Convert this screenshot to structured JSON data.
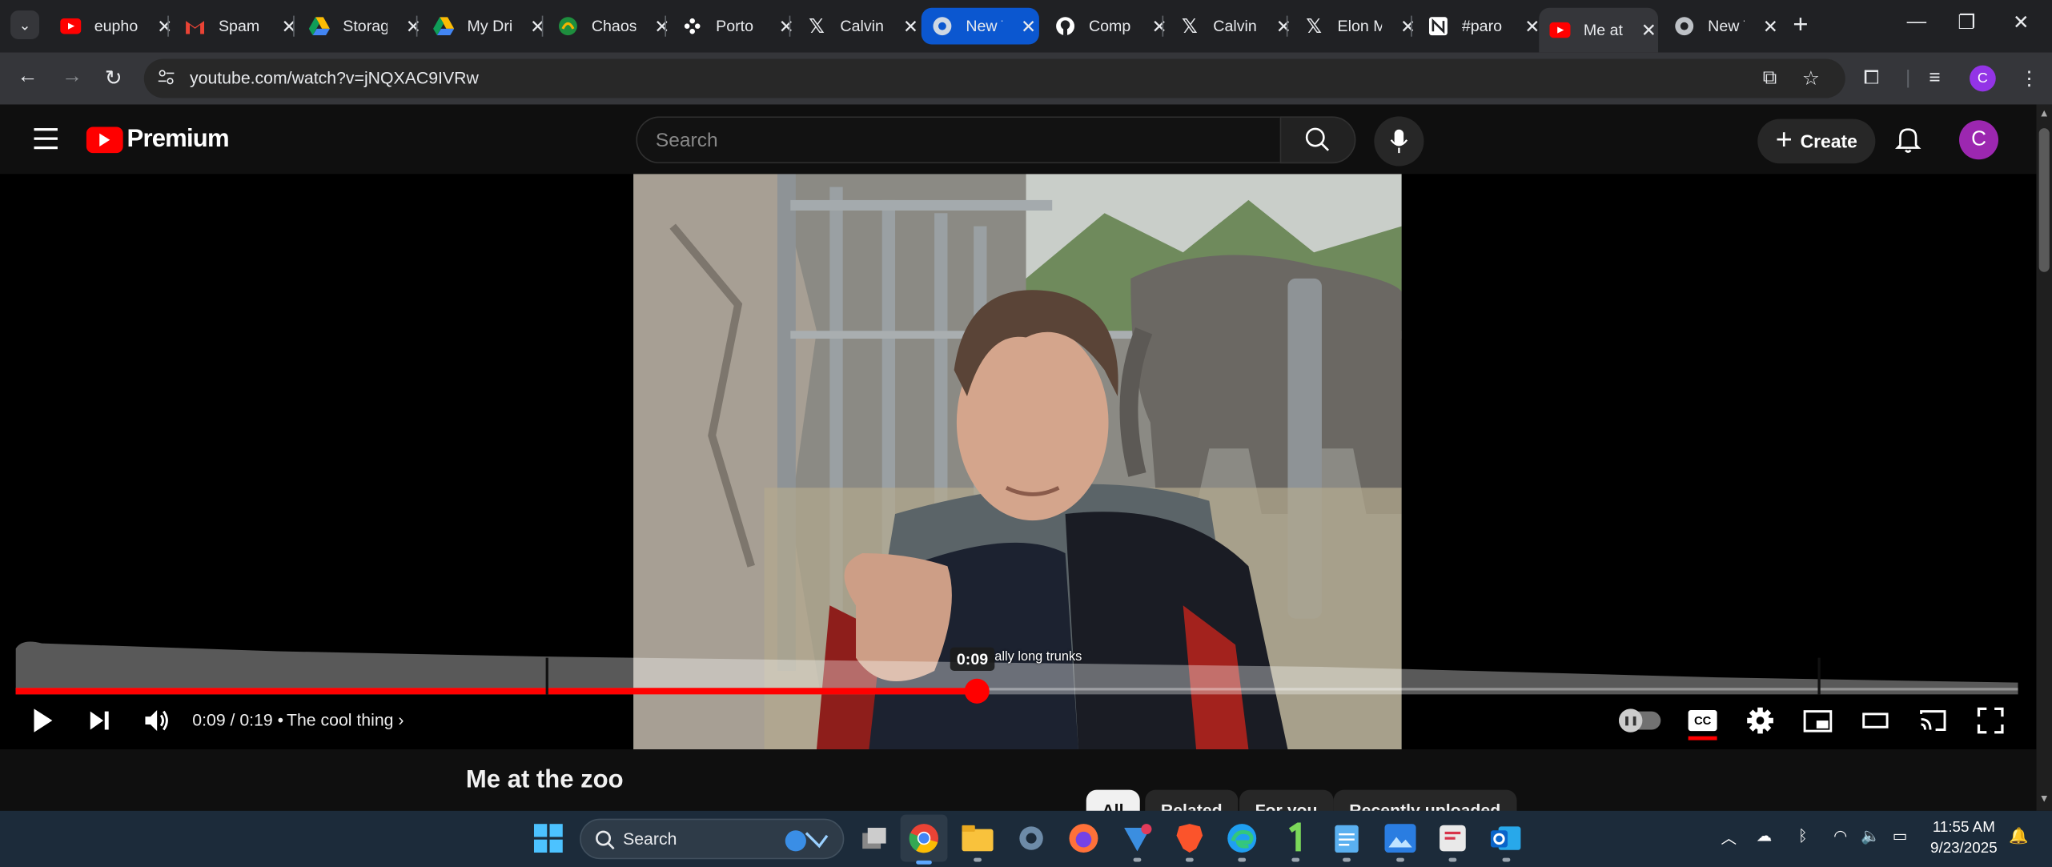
{
  "browser": {
    "tabs": [
      {
        "title": "euphoria",
        "icon": "youtube-icon"
      },
      {
        "title": "Spam",
        "icon": "gmail-icon"
      },
      {
        "title": "Storage",
        "icon": "google-drive-icon"
      },
      {
        "title": "My Drive",
        "icon": "google-drive-icon"
      },
      {
        "title": "Chaos",
        "icon": "chaos-icon"
      },
      {
        "title": "Porto",
        "icon": "porto-icon"
      },
      {
        "title": "Calvin",
        "icon": "x-icon"
      },
      {
        "title": "New Tab",
        "icon": "chrome-icon",
        "highlighted": true
      },
      {
        "title": "Comp",
        "icon": "github-icon"
      },
      {
        "title": "Calvin",
        "icon": "x-icon"
      },
      {
        "title": "Elon M",
        "icon": "x-icon"
      },
      {
        "title": "#paro",
        "icon": "notion-icon"
      },
      {
        "title": "Me at",
        "icon": "youtube-icon",
        "active": true
      },
      {
        "title": "New Tab",
        "icon": "chrome-icon"
      }
    ],
    "url": "youtube.com/watch?v=jNQXAC9IVRw",
    "profile_initial": "C"
  },
  "youtube": {
    "brand": "Premium",
    "search": {
      "placeholder": "Search"
    },
    "create_label": "Create",
    "avatar_initial": "C"
  },
  "player": {
    "time_current": "0:09",
    "time_total": "0:19",
    "time_display": "0:09 / 0:19",
    "chapter_sep": "•",
    "chapter_title": "The cool thing",
    "tooltip_time": "0:09",
    "tooltip_chapter": "ally long trunks",
    "progress_fraction": 0.48,
    "chapter_markers": [
      0.265,
      0.9
    ],
    "captions_on": true,
    "autoplay": false
  },
  "video": {
    "title": "Me at the zoo"
  },
  "filter_chips": [
    {
      "label": "All",
      "active": true
    },
    {
      "label": "Related",
      "active": false
    },
    {
      "label": "For you",
      "active": false
    },
    {
      "label": "Recently uploaded",
      "active": false
    }
  ],
  "taskbar": {
    "search_label": "Search",
    "time": "11:55 AM",
    "date": "9/23/2025"
  },
  "colors": {
    "accent_red": "#ff0000",
    "tab_highlight": "#0b57d0",
    "avatar_purple": "#9c27b0"
  }
}
